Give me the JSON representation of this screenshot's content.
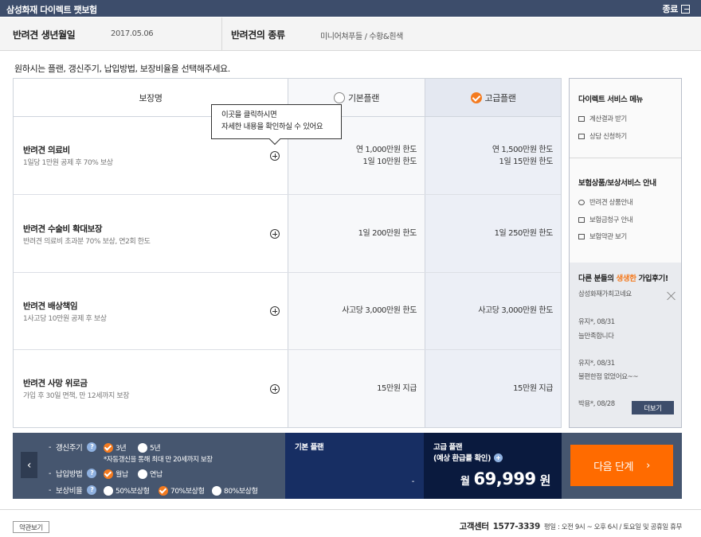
{
  "titlebar": {
    "title": "삼성화재 다이렉트 팻보험",
    "close_label": "종료"
  },
  "info": {
    "birth_label": "반려견 생년월일",
    "birth_value": "2017.05.06",
    "breed_label": "반려견의 종류",
    "breed_value": "미니어쳐푸들 / 수황&흰색"
  },
  "instruction": "원하시는 플랜, 갱신주기, 납입방법, 보장비율을 선택해주세요.",
  "table": {
    "header_name": "보장명",
    "plan_basic": "기본플랜",
    "plan_premium": "고급플랜",
    "rows": [
      {
        "title": "반려견 의료비",
        "desc": "1일당 1만원 공제 후 70% 보상",
        "basic": "연 1,000만원 한도\n1일 10만원 한도",
        "premium": "연 1,500만원 한도\n1일 15만원 한도"
      },
      {
        "title": "반려견 수술비 확대보장",
        "desc": "반려견 의료비 초과분 70% 보상, 연2회 한도",
        "basic": "1일 200만원 한도",
        "premium": "1일 250만원 한도"
      },
      {
        "title": "반려견 배상책임",
        "desc": "1사고당 10만원 공제 후 보상",
        "basic": "사고당 3,000만원 한도",
        "premium": "사고당 3,000만원 한도"
      },
      {
        "title": "반려견 사망 위로금",
        "desc": "가입 후 30일 면책, 만 12세까지 보장",
        "basic": "15만원 지급",
        "premium": "15만원 지급"
      }
    ]
  },
  "tooltip": {
    "line1": "이곳을 클릭하시면",
    "line2": "자세한 내용을 확인하실 수 있어요"
  },
  "sidebar": {
    "menu_title": "다이렉트 서비스 메뉴",
    "menu_items": [
      "계산결과 받기",
      "상담 신청하기"
    ],
    "info_title": "보험상품/보상서비스 안내",
    "info_items": [
      "반려견 상품안내",
      "보험금청구 안내",
      "보험약관 보기"
    ],
    "reviews_title_prefix": "다른 분들의 ",
    "reviews_title_highlight": "생생한",
    "reviews_title_suffix": " 가입후기!",
    "reviews": [
      {
        "text": "삼성화재가최고네요",
        "author": "유지*, 08/31"
      },
      {
        "text": "늘만족합니다",
        "author": "유지*, 08/31"
      },
      {
        "text": "불편한점 없었어요~~",
        "author": "박용*, 08/28"
      }
    ],
    "more_label": "더보기"
  },
  "options": {
    "renewal_label": "갱신주기",
    "renewal_choices": [
      "3년",
      "5년"
    ],
    "renewal_selected": "3년",
    "renewal_note": "*자동갱신을 통해 최대 만 20세까지 보장",
    "payment_label": "납입방법",
    "payment_choices": [
      "월납",
      "연납"
    ],
    "payment_selected": "월납",
    "ratio_label": "보상비율",
    "ratio_choices": [
      "50%보상형",
      "70%보상형",
      "80%보상형"
    ],
    "ratio_selected": "70%보상형",
    "help_glyph": "?",
    "dash": "-"
  },
  "price": {
    "basic_title": "기본 플랜",
    "basic_value": "-",
    "premium_title": "고급 플랜",
    "premium_subtitle": "(예상 환급률 확인)",
    "currency_prefix": "월",
    "amount": "69,999",
    "unit": "원"
  },
  "next_button": {
    "label": "다음 단계",
    "arrow": "›"
  },
  "prev_arrow": "‹",
  "footer": {
    "terms_label": "약관보기",
    "cs_label": "고객센터",
    "cs_number": "1577-3339",
    "cs_hours": "평일 : 오전 9시 ~ 오후 6시 / 토요일 및 공휴일 휴무"
  },
  "colors": {
    "accent": "#f47b20",
    "navy": "#3d4d6b",
    "next": "#ff6b00",
    "premium_bg": "#0a1a3e",
    "basic_bg": "#172e63"
  }
}
